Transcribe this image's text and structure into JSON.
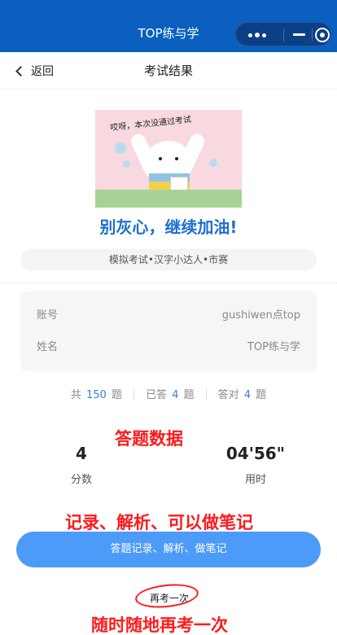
{
  "window": {
    "title": "TOP练与学"
  },
  "capsule": {
    "more_icon": "more-dots-icon",
    "minimize_icon": "minus-icon",
    "close_icon": "target-circle-icon"
  },
  "nav": {
    "back_label": "返回",
    "title": "考试结果"
  },
  "illustration": {
    "caption": "哎呀，本次没通过考试"
  },
  "result": {
    "headline": "别灰心，继续加油!",
    "exam_path": "模拟考试•汉字小达人•市赛"
  },
  "account": {
    "rows": [
      {
        "label": "账号",
        "value": "gushiwen点top"
      },
      {
        "label": "姓名",
        "value": "TOP练与学"
      }
    ]
  },
  "stats": {
    "total_prefix": "共",
    "total": "150",
    "total_suffix": "题",
    "answered_prefix": "已答",
    "answered": "4",
    "answered_suffix": "题",
    "correct_prefix": "答对",
    "correct": "4",
    "correct_suffix": "题"
  },
  "summary": {
    "score_value": "4",
    "score_label": "分数",
    "time_value": "04'56\"",
    "time_label": "用时"
  },
  "actions": {
    "records_button": "答题记录、解析、做笔记",
    "retake_link": "再考一次"
  },
  "annotations": {
    "data_note": "答题数据",
    "records_note": "记录、解析、可以做笔记",
    "retake_note": "随时随地再考一次"
  },
  "colors": {
    "topbar": "#0a5fbf",
    "headline": "#1f6fd1",
    "button": "#4d9bf9",
    "annotation": "#ff1a1a"
  }
}
